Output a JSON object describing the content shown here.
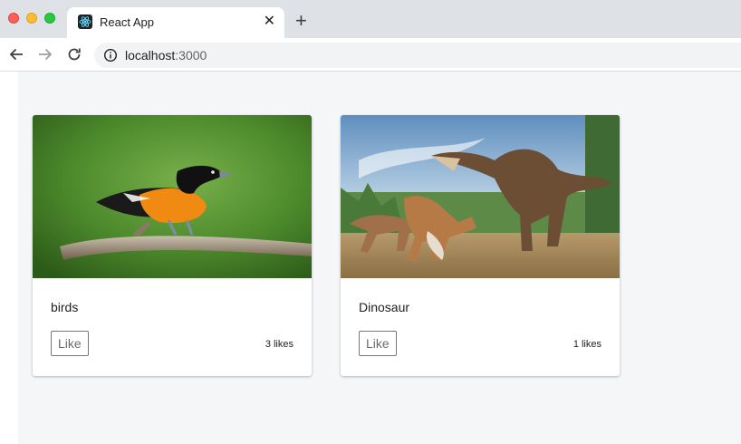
{
  "browser": {
    "tab_title": "React App",
    "tab_close": "✕",
    "new_tab": "+",
    "url_host": "localhost",
    "url_port": ":3000"
  },
  "cards": [
    {
      "title": "birds",
      "like_label": "Like",
      "likes_text": "3 likes",
      "image": "bird-photo"
    },
    {
      "title": "Dinosaur",
      "like_label": "Like",
      "likes_text": "1 likes",
      "image": "dinosaur-illustration"
    }
  ]
}
